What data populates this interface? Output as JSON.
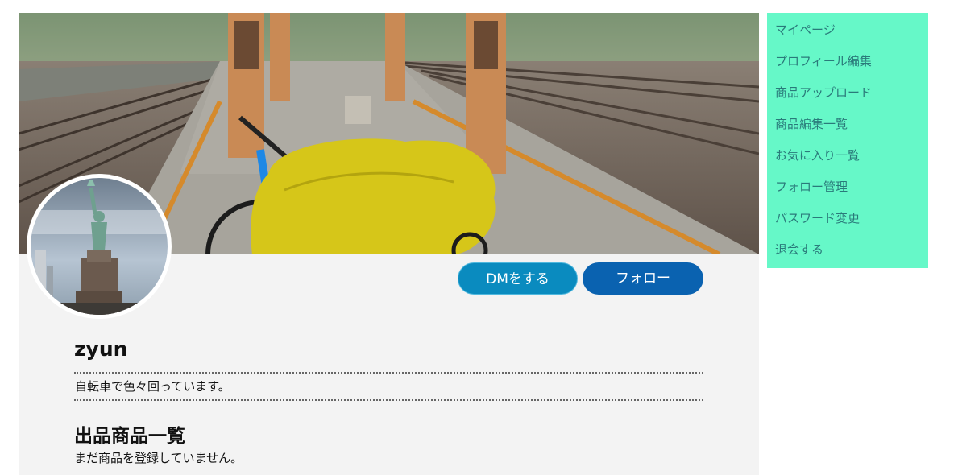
{
  "profile": {
    "username": "zyun",
    "bio": "自転車で色々回っています。"
  },
  "actions": {
    "dm_label": "DMをする",
    "follow_label": "フォロー"
  },
  "products": {
    "title": "出品商品一覧",
    "empty_message": "まだ商品を登録していません。"
  },
  "sidebar": {
    "items": [
      {
        "label": "マイページ"
      },
      {
        "label": "プロフィール編集"
      },
      {
        "label": "商品アップロード"
      },
      {
        "label": "商品編集一覧"
      },
      {
        "label": "お気に入り一覧"
      },
      {
        "label": "フォロー管理"
      },
      {
        "label": "パスワード変更"
      },
      {
        "label": "退会する"
      }
    ]
  },
  "colors": {
    "sidebar_bg": "#66f8c8",
    "sidebar_text": "#2a7a7a",
    "dm_button": "#0a8bbf",
    "follow_button": "#0a62b0",
    "content_bg": "#f3f3f3"
  }
}
